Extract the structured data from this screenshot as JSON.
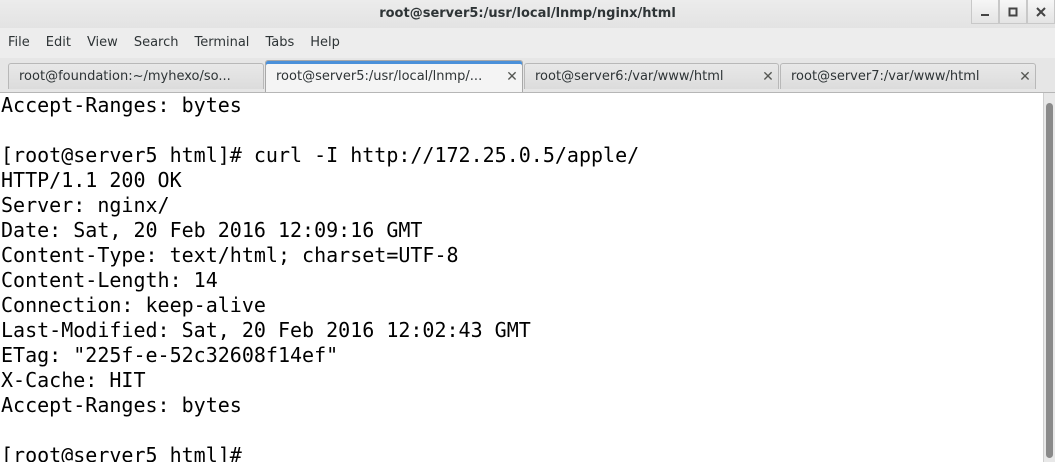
{
  "window": {
    "title": "root@server5:/usr/local/lnmp/nginx/html",
    "controls": [
      "minimize",
      "maximize",
      "close"
    ]
  },
  "menu": {
    "items": [
      "File",
      "Edit",
      "View",
      "Search",
      "Terminal",
      "Tabs",
      "Help"
    ]
  },
  "tabs": [
    {
      "label": "root@foundation:~/myhexo/so...",
      "active": false
    },
    {
      "label": "root@server5:/usr/local/lnmp/...",
      "active": true
    },
    {
      "label": "root@server6:/var/www/html",
      "active": false
    },
    {
      "label": "root@server7:/var/www/html",
      "active": false
    }
  ],
  "tab_close_glyph": "✕",
  "terminal": {
    "lines": [
      "Accept-Ranges: bytes",
      "",
      "[root@server5 html]# curl -I http://172.25.0.5/apple/",
      "HTTP/1.1 200 OK",
      "Server: nginx/",
      "Date: Sat, 20 Feb 2016 12:09:16 GMT",
      "Content-Type: text/html; charset=UTF-8",
      "Content-Length: 14",
      "Connection: keep-alive",
      "Last-Modified: Sat, 20 Feb 2016 12:02:43 GMT",
      "ETag: \"225f-e-52c32608f14ef\"",
      "X-Cache: HIT",
      "Accept-Ranges: bytes",
      "",
      "[root@server5 html]# "
    ]
  }
}
